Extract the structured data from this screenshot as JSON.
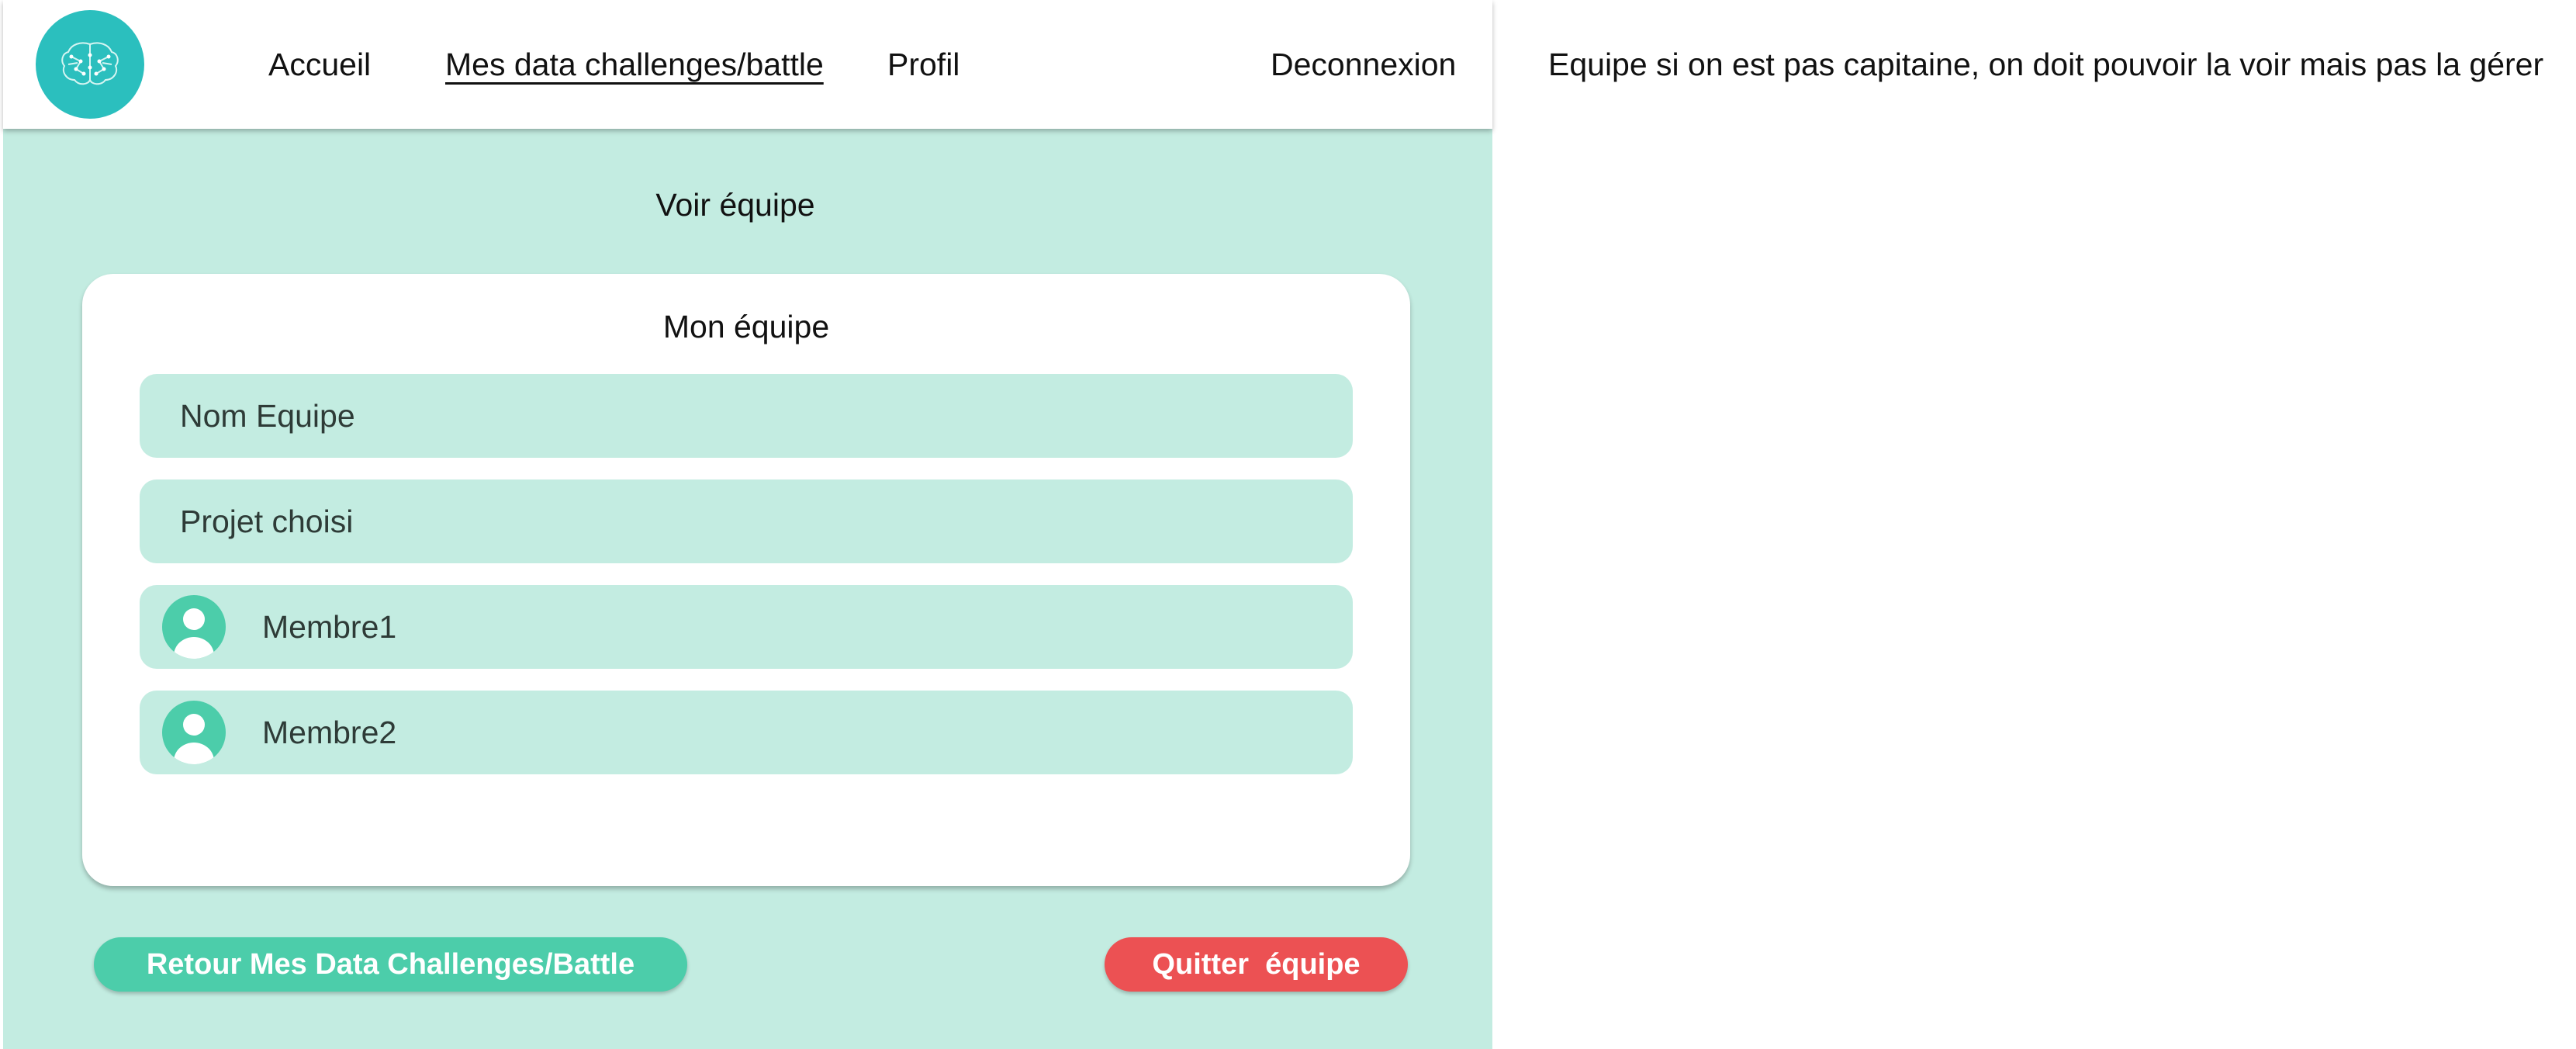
{
  "nav": {
    "logo_icon": "brain-icon",
    "home": "Accueil",
    "challenges": "Mes data challenges/battle",
    "profile": "Profil",
    "logout": "Deconnexion"
  },
  "note": "Equipe si on est pas capitaine, on doit pouvoir la voir mais pas la gérer",
  "page": {
    "title": "Voir équipe"
  },
  "team_card": {
    "title": "Mon équipe",
    "team_name": "Nom Equipe",
    "project": "Projet choisi",
    "members": [
      {
        "name": "Membre1",
        "icon": "user-avatar-icon"
      },
      {
        "name": "Membre2",
        "icon": "user-avatar-icon"
      }
    ]
  },
  "buttons": {
    "back": "Retour Mes Data Challenges/Battle",
    "quit": "Quitter  équipe"
  },
  "colors": {
    "accent_teal": "#2bbfbe",
    "panel_mint": "#c3ece1",
    "button_green": "#4ccdaa",
    "button_red": "#ec5153"
  }
}
